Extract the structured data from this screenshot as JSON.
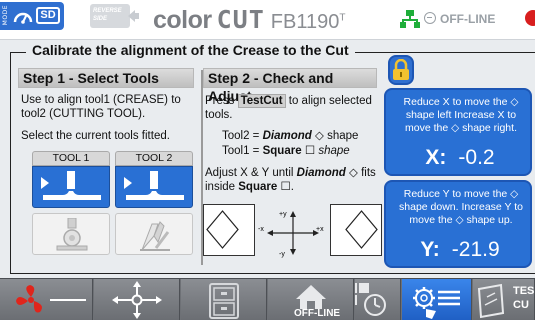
{
  "header": {
    "mode_tag": "MODE",
    "sd_badge": "SD",
    "reverse_label_line1": "REVERSE",
    "reverse_label_line2": "SIDE",
    "brand_color": "color",
    "brand_cut": "CUT",
    "brand_model": "FB1190",
    "brand_sup": "T",
    "connection_status": "OFF-LINE",
    "status_color": "#d81e1e"
  },
  "title": "Calibrate the alignment of the Crease to the Cut",
  "step1": {
    "header": "Step 1 - Select Tools",
    "instruction": "Use to align tool1 (CREASE) to tool2 (CUTTING TOOL).",
    "select_text": "Select the current tools fitted.",
    "tools": [
      {
        "label": "TOOL 1",
        "icon": "crease-tool-icon",
        "sub_icon": "crease-wheel-icon"
      },
      {
        "label": "TOOL 2",
        "icon": "crease-tool-icon",
        "sub_icon": "cutting-blade-icon"
      }
    ]
  },
  "step2": {
    "header": "Step 2 - Check and Adjust",
    "press": "Press",
    "testcut_button": "TestCut",
    "instruction_rest": "to align selected tools.",
    "tool2_prefix": "Tool2 =",
    "tool2_shape": "Diamond",
    "tool2_suffix": "shape",
    "tool1_prefix": "Tool1 =",
    "tool1_shape": "Square",
    "tool1_suffix": "shape",
    "adjust_prefix": "Adjust  X & Y until",
    "adjust_shape": "Diamond",
    "adjust_mid": "fits inside",
    "adjust_shape2": "Square",
    "axis_labels": {
      "plus_y": "+y",
      "minus_y": "-y",
      "plus_x": "+x",
      "minus_x": "-x"
    }
  },
  "adjust_x": {
    "text": "Reduce X to move the ◇ shape left  Increase X to move the ◇ shape right.",
    "label": "X:",
    "value": "-0.2"
  },
  "adjust_y": {
    "text": "Reduce Y to move the ◇ shape down.  Increase Y to move the ◇ shape up.",
    "label": "Y:",
    "value": "-21.9"
  },
  "toolbar": {
    "offline_label": "OFF-LINE",
    "testcut_label_line1": "TES",
    "testcut_label_line2": "CU",
    "active_color": "#2a73de"
  }
}
